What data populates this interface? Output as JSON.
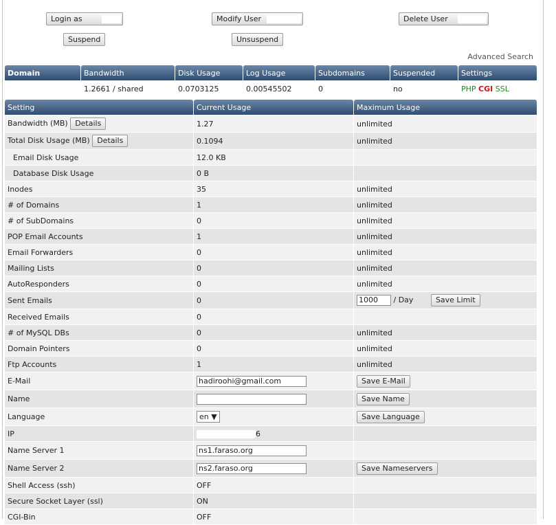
{
  "top_buttons": {
    "login_as": "Login as",
    "modify_user": "Modify User",
    "delete_user": "Delete User",
    "suspend": "Suspend",
    "unsuspend": "Unsuspend"
  },
  "advanced_search": "Advanced Search",
  "domain_table": {
    "headers": [
      "Domain",
      "Bandwidth",
      "Disk Usage",
      "Log Usage",
      "Subdomains",
      "Suspended",
      "Settings"
    ],
    "row": {
      "domain": "",
      "bandwidth": "1.2661 / shared",
      "disk": "0.0703125",
      "log": "0.00545502",
      "subdomains": "0",
      "suspended": "no",
      "php": "PHP",
      "cgi": "CGI",
      "ssl": "SSL"
    }
  },
  "settings_table": {
    "headers": [
      "Setting",
      "Current Usage",
      "Maximum Usage"
    ],
    "details_label": "Details",
    "rows": [
      {
        "setting": "Bandwidth (MB)",
        "current": "1.27",
        "max": "unlimited"
      },
      {
        "setting": "Total Disk Usage (MB)",
        "current": "0.1094",
        "max": "unlimited"
      },
      {
        "setting": "Email Disk Usage",
        "current": "12.0 KB",
        "max": ""
      },
      {
        "setting": "Database Disk Usage",
        "current": "0 B",
        "max": ""
      },
      {
        "setting": "Inodes",
        "current": "35",
        "max": "unlimited"
      },
      {
        "setting": "# of Domains",
        "current": "1",
        "max": "unlimited"
      },
      {
        "setting": "# of SubDomains",
        "current": "0",
        "max": "unlimited"
      },
      {
        "setting": "POP Email Accounts",
        "current": "1",
        "max": "unlimited"
      },
      {
        "setting": "Email Forwarders",
        "current": "0",
        "max": "unlimited"
      },
      {
        "setting": "Mailing Lists",
        "current": "0",
        "max": "unlimited"
      },
      {
        "setting": "AutoResponders",
        "current": "0",
        "max": "unlimited"
      },
      {
        "setting": "Sent Emails",
        "current": "0",
        "limit_value": "1000",
        "per_day": "/ Day",
        "save_limit": "Save Limit"
      },
      {
        "setting": "Received Emails",
        "current": "0",
        "max": ""
      },
      {
        "setting": "# of MySQL DBs",
        "current": "0",
        "max": "unlimited"
      },
      {
        "setting": "Domain Pointers",
        "current": "0",
        "max": "unlimited"
      },
      {
        "setting": "Ftp Accounts",
        "current": "1",
        "max": "unlimited"
      },
      {
        "setting": "E-Mail",
        "value": "hadiroohi@gmail.com",
        "button": "Save E-Mail"
      },
      {
        "setting": "Name",
        "value": "",
        "button": "Save Name"
      },
      {
        "setting": "Language",
        "value": "en",
        "button": "Save Language"
      },
      {
        "setting": "IP",
        "value": "6"
      },
      {
        "setting": "Name Server 1",
        "value": "ns1.faraso.org"
      },
      {
        "setting": "Name Server 2",
        "value": "ns2.faraso.org",
        "button": "Save Nameservers"
      },
      {
        "setting": "Shell Access (ssh)",
        "current": "OFF"
      },
      {
        "setting": "Secure Socket Layer (ssl)",
        "current": "ON"
      },
      {
        "setting": "CGI-Bin",
        "current": "OFF"
      }
    ]
  }
}
